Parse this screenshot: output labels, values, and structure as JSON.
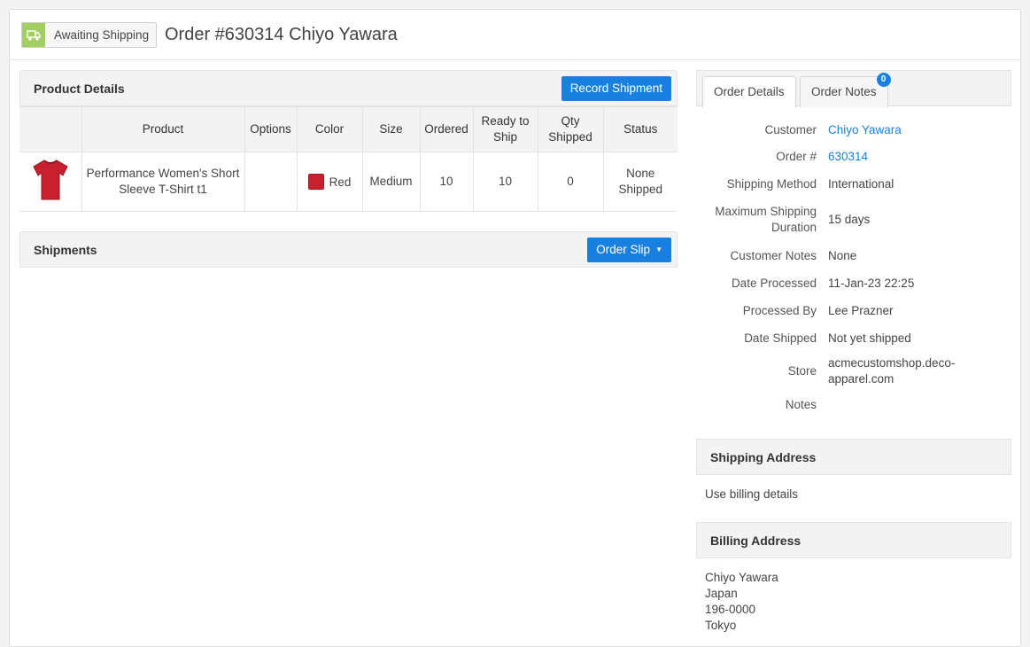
{
  "header": {
    "status": "Awaiting Shipping",
    "title": "Order #630314 Chiyo Yawara"
  },
  "product_details": {
    "title": "Product Details",
    "record_button": "Record Shipment",
    "columns": [
      "",
      "Product",
      "Options",
      "Color",
      "Size",
      "Ordered",
      "Ready to Ship",
      "Qty Shipped",
      "Status"
    ],
    "rows": [
      {
        "product": "Performance Women's Short Sleeve T-Shirt t1",
        "options": "",
        "color": "Red",
        "size": "Medium",
        "ordered": "10",
        "ready": "10",
        "shipped": "0",
        "status": "None Shipped"
      }
    ]
  },
  "shipments": {
    "title": "Shipments",
    "order_slip_button": "Order Slip"
  },
  "tabs": {
    "order_details": "Order Details",
    "order_notes": "Order Notes",
    "notes_count": "0"
  },
  "details": {
    "customer_label": "Customer",
    "customer_value": "Chiyo Yawara",
    "order_label": "Order #",
    "order_value": "630314",
    "shipping_method_label": "Shipping Method",
    "shipping_method_value": "International",
    "max_duration_label": "Maximum Shipping Duration",
    "max_duration_value": "15 days",
    "customer_notes_label": "Customer Notes",
    "customer_notes_value": "None",
    "date_processed_label": "Date Processed",
    "date_processed_value": "11-Jan-23 22:25",
    "processed_by_label": "Processed By",
    "processed_by_value": "Lee Prazner",
    "date_shipped_label": "Date Shipped",
    "date_shipped_value": "Not yet shipped",
    "store_label": "Store",
    "store_value": "acmecustomshop.deco-apparel.com",
    "notes_label": "Notes",
    "notes_value": ""
  },
  "shipping_address": {
    "title": "Shipping Address",
    "text": "Use billing details"
  },
  "billing_address": {
    "title": "Billing Address",
    "lines": [
      "Chiyo Yawara",
      "Japan",
      "196-0000",
      "Tokyo"
    ]
  },
  "colors": {
    "accent": "#1a80e0",
    "status": "#a3cf62",
    "swatch_red": "#c8202e"
  }
}
